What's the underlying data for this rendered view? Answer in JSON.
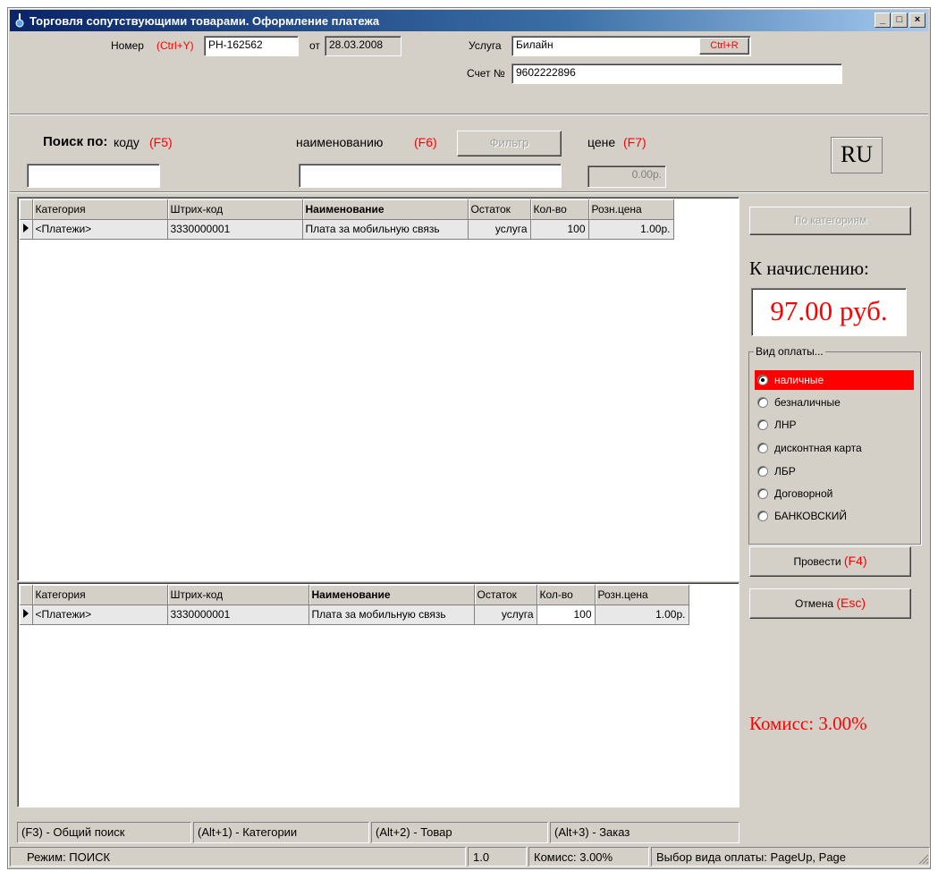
{
  "window": {
    "title": "Торговля сопутствующими товарами. Оформление платежа",
    "min": "_",
    "max": "□",
    "close": "×"
  },
  "header": {
    "number_label": "Номер",
    "number_hotkey": "(Ctrl+Y)",
    "number_value": "РН-162562",
    "date_label": "от",
    "date_value": "28.03.2008",
    "service_label": "Услуга",
    "service_value": "Билайн",
    "service_hotkey_btn": "Ctrl+R",
    "account_label": "Счет №",
    "account_value": "9602222896"
  },
  "search": {
    "title": "Поиск по:",
    "by_code": "коду",
    "by_code_key": "(F5)",
    "by_name": "наименованию",
    "by_name_key": "(F6)",
    "filter_btn": "Фильтр",
    "by_price": "цене",
    "by_price_key": "(F7)",
    "code_value": "",
    "name_value": "",
    "price_value": "0.00р.",
    "lang": "RU"
  },
  "grid_top": {
    "columns": [
      "Категория",
      "Штрих-код",
      "Наименование",
      "Остаток",
      "Кол-во",
      "Розн.цена"
    ],
    "rows": [
      [
        "<Платежи>",
        "3330000001",
        "Плата за мобильную связь",
        "услуга",
        "100",
        "1.00р."
      ]
    ]
  },
  "grid_bottom": {
    "columns": [
      "Категория",
      "Штрих-код",
      "Наименование",
      "Остаток",
      "Кол-во",
      "Розн.цена"
    ],
    "rows": [
      [
        "<Платежи>",
        "3330000001",
        "Плата за мобильную связь",
        "услуга",
        "100",
        "1.00р."
      ]
    ]
  },
  "side": {
    "by_category_btn": "По категориям",
    "accrual_label": "К начислению:",
    "accrual_value": "97.00 руб.",
    "payment_group": "Вид оплаты...",
    "payment_options": [
      "наличные",
      "безналичные",
      "ЛНР",
      "дисконтная карта",
      "ЛБР",
      "Договорной",
      "БАНКОВСКИЙ"
    ],
    "payment_selected": "наличные",
    "post_btn": "Провести",
    "post_key": "(F4)",
    "cancel_btn": "Отмена",
    "cancel_key": "(Esc)",
    "commission": "Комисс: 3.00%"
  },
  "hints": [
    "(F3) - Общий поиск",
    "(Alt+1) - Категории",
    "(Alt+2) - Товар",
    "(Alt+3) - Заказ"
  ],
  "statusbar": {
    "mode": "Режим: ПОИСК",
    "version": "1.0",
    "commission": "Комисс: 3.00%",
    "hint": "Выбор вида оплаты: PageUp, Page"
  },
  "colors": {
    "accent_red": "#ff0000",
    "face": "#d4d0c8",
    "title_start": "#0a246a",
    "title_end": "#a6caf0"
  }
}
